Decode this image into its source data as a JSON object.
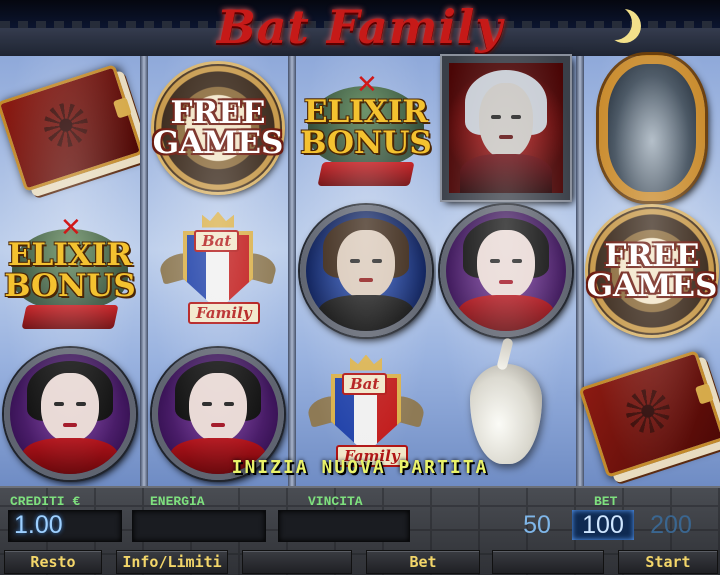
{
  "game": {
    "title": "Bat Family",
    "status_message": "INIZIA NUOVA PARTITA"
  },
  "reels": [
    [
      {
        "symbol": "spellbook",
        "icon": "spellbook-icon"
      },
      {
        "symbol": "elixir-bonus",
        "text_line1": "ELIXIR",
        "text_line2": "BONUS"
      },
      {
        "symbol": "vampire-woman",
        "icon": "vampire-woman-icon"
      }
    ],
    [
      {
        "symbol": "free-games",
        "text_line1": "FREE",
        "text_line2": "GAMES"
      },
      {
        "symbol": "bat-family-crest",
        "text_line1": "Bat",
        "text_line2": "Family"
      },
      {
        "symbol": "vampire-woman",
        "icon": "vampire-woman-icon"
      }
    ],
    [
      {
        "symbol": "elixir-bonus",
        "text_line1": "ELIXIR",
        "text_line2": "BONUS"
      },
      {
        "symbol": "vampire-man",
        "icon": "vampire-man-icon"
      },
      {
        "symbol": "bat-family-crest",
        "text_line1": "Bat",
        "text_line2": "Family"
      }
    ],
    [
      {
        "symbol": "count-dracula",
        "icon": "dracula-portrait-icon"
      },
      {
        "symbol": "vampire-woman",
        "icon": "vampire-woman-icon"
      },
      {
        "symbol": "garlic",
        "icon": "garlic-icon"
      }
    ],
    [
      {
        "symbol": "mirror",
        "icon": "mirror-icon"
      },
      {
        "symbol": "free-games",
        "text_line1": "FREE",
        "text_line2": "GAMES"
      },
      {
        "symbol": "spellbook",
        "icon": "spellbook-icon"
      }
    ]
  ],
  "panel": {
    "credits_label": "CREDITI €",
    "credits_value": "1.00",
    "energy_label": "ENERGIA",
    "energy_value": "",
    "win_label": "VINCITA",
    "win_value": "",
    "bet_label": "BET",
    "bet_options": [
      "50",
      "100",
      "200"
    ],
    "bet_selected": "100"
  },
  "buttons": {
    "resto": "Resto",
    "info": "Info/Limiti",
    "bet": "Bet",
    "start": "Start"
  },
  "colors": {
    "title_red": "#c61a18",
    "message_yellow": "#e9f26a",
    "label_green": "#7ee07e",
    "display_blue": "#9ed0ff",
    "button_text": "#f3d66a"
  }
}
